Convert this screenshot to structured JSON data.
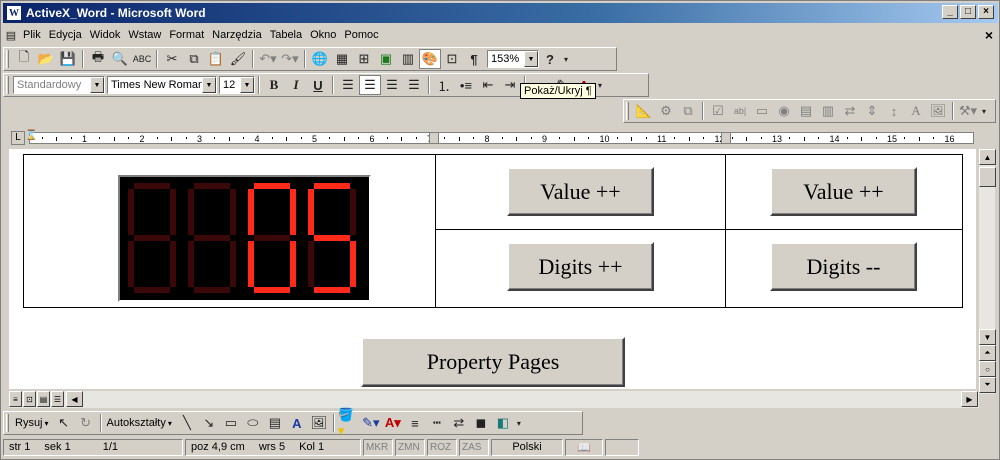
{
  "window": {
    "title": "ActiveX_Word - Microsoft Word",
    "app_icon": "W"
  },
  "menu": [
    "Plik",
    "Edycja",
    "Widok",
    "Wstaw",
    "Format",
    "Narzędzia",
    "Tabela",
    "Okno",
    "Pomoc"
  ],
  "toolbar": {
    "zoom": "153%",
    "style": "Standardowy",
    "font": "Times New Roman",
    "size": "12",
    "tooltip": "Pokaż/Ukryj ¶"
  },
  "ruler": {
    "numbers": [
      "1",
      "2",
      "3",
      "4",
      "5",
      "6",
      "7",
      "8",
      "9",
      "10",
      "11",
      "12",
      "13",
      "14",
      "15",
      "16"
    ]
  },
  "document": {
    "led": {
      "digits": [
        "",
        "",
        "0",
        "5"
      ],
      "on_color": "#ff2a1a",
      "off_color": "#3a0808"
    },
    "buttons": {
      "value_inc_1": "Value ++",
      "value_inc_2": "Value ++",
      "digits_inc": "Digits ++",
      "digits_dec": "Digits --",
      "property_pages": "Property Pages"
    }
  },
  "drawing": {
    "draw_label": "Rysuj",
    "autoshapes_label": "Autokształty"
  },
  "status": {
    "page": "str 1",
    "section": "sek 1",
    "pages": "1/1",
    "pos": "poz 4,9 cm",
    "line": "wrs 5",
    "col": "Kol 1",
    "mkr": "MKR",
    "zmn": "ZMN",
    "roz": "ROZ",
    "zas": "ZAS",
    "lang": "Polski"
  }
}
